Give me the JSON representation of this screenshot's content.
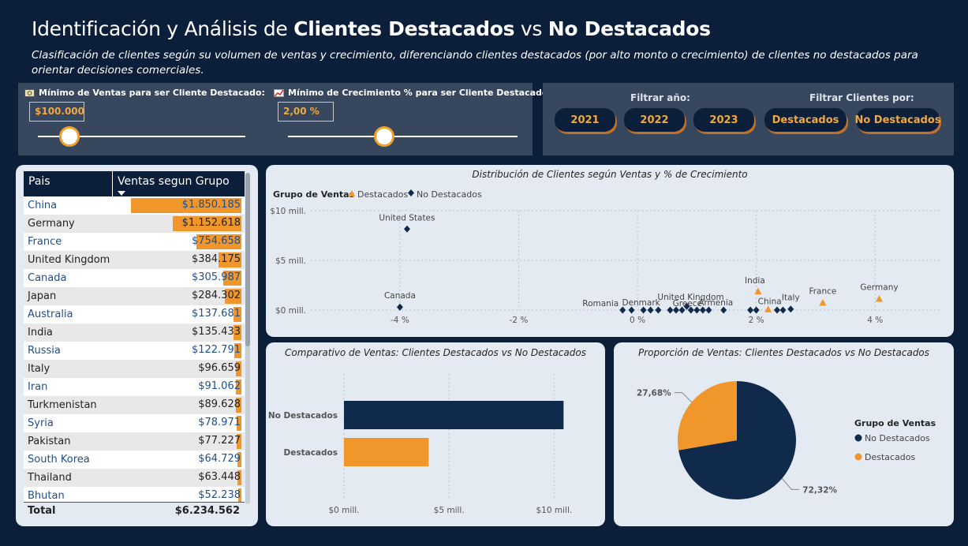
{
  "header": {
    "title_prefix": "Identificación y Análisis de ",
    "title_bold1": "Clientes Destacados",
    "title_mid": " vs ",
    "title_bold2": "No Destacados",
    "subtitle": "Clasificación de clientes según su volumen de ventas y crecimiento, diferenciando clientes destacados (por alto monto o crecimiento) de clientes no destacados para orientar decisiones comerciales."
  },
  "colors": {
    "background": "#0b1f3a",
    "panel": "#37475d",
    "card": "#e3eaf2",
    "destacados": "#f0962a",
    "no_destacados": "#102a4c"
  },
  "slicers": {
    "sales": {
      "label": "Mínimo de Ventas para ser Cliente Destacado:",
      "icon": "money-icon",
      "value": "$100.000",
      "slider_fraction": 0.15
    },
    "growth": {
      "label": "Mínimo de Crecimiento % para ser Cliente Destacado:",
      "icon": "trend-chart-icon",
      "value": "2,00 %",
      "slider_fraction": 0.42
    }
  },
  "filters": {
    "year_label": "Filtrar año:",
    "years": [
      "2021",
      "2022",
      "2023"
    ],
    "clients_label": "Filtrar Clientes por:",
    "clients": [
      "Destacados",
      "No Destacados"
    ]
  },
  "table": {
    "col_country": "Pais",
    "col_sales": "Ventas segun Grupo",
    "rows": [
      {
        "country": "China",
        "sales": "$1.850.185",
        "value": 1850185
      },
      {
        "country": "Germany",
        "sales": "$1.152.618",
        "value": 1152618
      },
      {
        "country": "France",
        "sales": "$754.658",
        "value": 754658
      },
      {
        "country": "United Kingdom",
        "sales": "$384.175",
        "value": 384175
      },
      {
        "country": "Canada",
        "sales": "$305.987",
        "value": 305987
      },
      {
        "country": "Japan",
        "sales": "$284.302",
        "value": 284302
      },
      {
        "country": "Australia",
        "sales": "$137.681",
        "value": 137681
      },
      {
        "country": "India",
        "sales": "$135.433",
        "value": 135433
      },
      {
        "country": "Russia",
        "sales": "$122.791",
        "value": 122791
      },
      {
        "country": "Italy",
        "sales": "$96.659",
        "value": 96659
      },
      {
        "country": "Iran",
        "sales": "$91.062",
        "value": 91062
      },
      {
        "country": "Turkmenistan",
        "sales": "$89.628",
        "value": 89628
      },
      {
        "country": "Syria",
        "sales": "$78.971",
        "value": 78971
      },
      {
        "country": "Pakistan",
        "sales": "$77.227",
        "value": 77227
      },
      {
        "country": "South Korea",
        "sales": "$64.729",
        "value": 64729
      },
      {
        "country": "Thailand",
        "sales": "$63.448",
        "value": 63448
      },
      {
        "country": "Bhutan",
        "sales": "$52.238",
        "value": 52238
      }
    ],
    "total_label": "Total",
    "total_value": "$6.234.562"
  },
  "chart_data": [
    {
      "type": "scatter",
      "title": "Distribución de Clientes según Ventas y % de Crecimiento",
      "legend_title": "Grupo de Ventas",
      "legend_position": "top-left",
      "xlim": [
        -5.5,
        5.1
      ],
      "ylim": [
        0,
        10
      ],
      "x_ticks": [
        -4,
        -2,
        0,
        2,
        4
      ],
      "x_tick_labels": [
        "-4 %",
        "-2 %",
        "0 %",
        "2 %",
        "4 %"
      ],
      "y_ticks": [
        0,
        5,
        10
      ],
      "y_tick_labels": [
        "$0 mill.",
        "$5 mill.",
        "$10 mill."
      ],
      "grid": true,
      "series": [
        {
          "name": "Destacados",
          "marker": "triangle",
          "color": "#f0962a",
          "points": [
            {
              "label": "Germany",
              "x": 4.07,
              "y": 1.15
            },
            {
              "label": "France",
              "x": 3.12,
              "y": 0.75
            },
            {
              "label": "India",
              "x": 2.03,
              "y": 1.9
            },
            {
              "label": "China",
              "x": 2.2,
              "y": 0.1
            }
          ]
        },
        {
          "name": "No Destacados",
          "marker": "diamond",
          "color": "#102a4c",
          "points": [
            {
              "label": "United States",
              "x": -3.88,
              "y": 8.15
            },
            {
              "label": "Canada",
              "x": -4.0,
              "y": 0.3
            },
            {
              "label": "Romania",
              "x": -0.25,
              "y": 0.0
            },
            {
              "label": "Denmark",
              "x": 0.22,
              "y": 0.0
            },
            {
              "label": "United Kingdom",
              "x": 0.83,
              "y": 0.38
            },
            {
              "label": "Greece",
              "x": 1.0,
              "y": 0.0
            },
            {
              "label": "Armenia",
              "x": 1.45,
              "y": 0.0
            },
            {
              "label": "Italy",
              "x": 2.58,
              "y": 0.1
            },
            {
              "label": "",
              "x": -0.1,
              "y": 0.0
            },
            {
              "label": "",
              "x": 0.1,
              "y": 0.0
            },
            {
              "label": "",
              "x": 0.35,
              "y": 0.0
            },
            {
              "label": "",
              "x": 0.55,
              "y": 0.0
            },
            {
              "label": "",
              "x": 0.65,
              "y": 0.0
            },
            {
              "label": "",
              "x": 0.75,
              "y": 0.0
            },
            {
              "label": "",
              "x": 0.9,
              "y": 0.0
            },
            {
              "label": "",
              "x": 1.1,
              "y": 0.0
            },
            {
              "label": "",
              "x": 1.2,
              "y": 0.0
            },
            {
              "label": "",
              "x": 1.9,
              "y": 0.0
            },
            {
              "label": "",
              "x": 2.0,
              "y": 0.0
            },
            {
              "label": "",
              "x": 2.35,
              "y": 0.0
            },
            {
              "label": "",
              "x": 2.45,
              "y": 0.0
            }
          ]
        }
      ]
    },
    {
      "type": "bar",
      "orientation": "horizontal",
      "title": "Comparativo de Ventas: Clientes Destacados vs No Destacados",
      "categories": [
        "No Destacados",
        "Destacados"
      ],
      "values": [
        10.45,
        4.03
      ],
      "colors": [
        "#102a4c",
        "#f0962a"
      ],
      "xlim": [
        0,
        11
      ],
      "x_ticks": [
        0,
        5,
        10
      ],
      "x_tick_labels": [
        "$0 mill.",
        "$5 mill.",
        "$10 mill."
      ],
      "grid": true
    },
    {
      "type": "pie",
      "title": "Proporción de Ventas: Clientes Destacados vs No Destacados",
      "legend_title": "Grupo de Ventas",
      "legend_position": "right",
      "slices": [
        {
          "name": "No Destacados",
          "value": 72.32,
          "label": "72,32%",
          "color": "#102a4c"
        },
        {
          "name": "Destacados",
          "value": 27.68,
          "label": "27,68%",
          "color": "#f0962a"
        }
      ]
    }
  ]
}
